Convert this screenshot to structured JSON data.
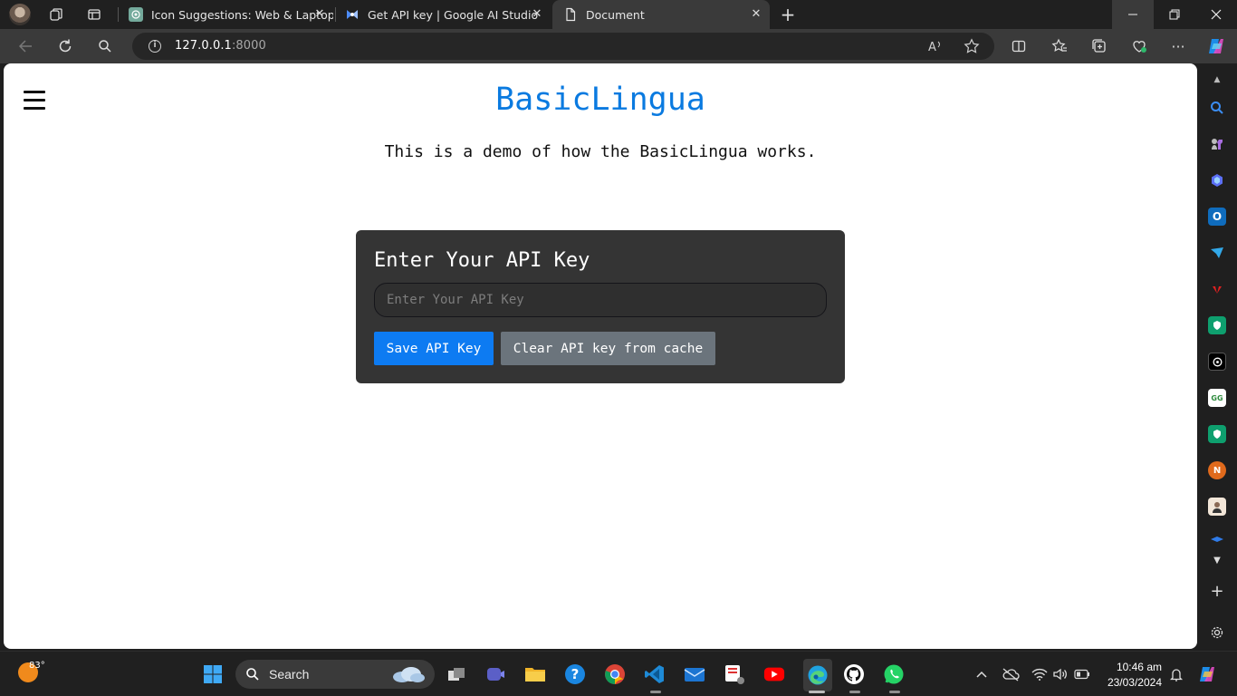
{
  "browser": {
    "tabs": [
      {
        "title": "Icon Suggestions: Web & Laptop",
        "icon": "chatgpt-icon",
        "active": false
      },
      {
        "title": "Get API key | Google AI Studio",
        "icon": "google-ai-studio-icon",
        "active": false
      },
      {
        "title": "Document",
        "icon": "document-icon",
        "active": true
      }
    ],
    "url_host": "127.0.0.1",
    "url_port": ":8000"
  },
  "page": {
    "title": "BasicLingua",
    "subtitle": "This is a demo of how the BasicLingua works.",
    "card": {
      "heading": "Enter Your API Key",
      "input_placeholder": "Enter Your API Key",
      "input_value": "",
      "save_label": "Save API Key",
      "clear_label": "Clear API key from cache"
    },
    "colors": {
      "title": "#0a7ae0",
      "save_button": "#0d7bf2",
      "clear_button": "#6b747c",
      "card": "#343434"
    }
  },
  "taskbar": {
    "weather_temp": "83°",
    "search_label": "Search",
    "time": "10:46 am",
    "date": "23/03/2024"
  }
}
